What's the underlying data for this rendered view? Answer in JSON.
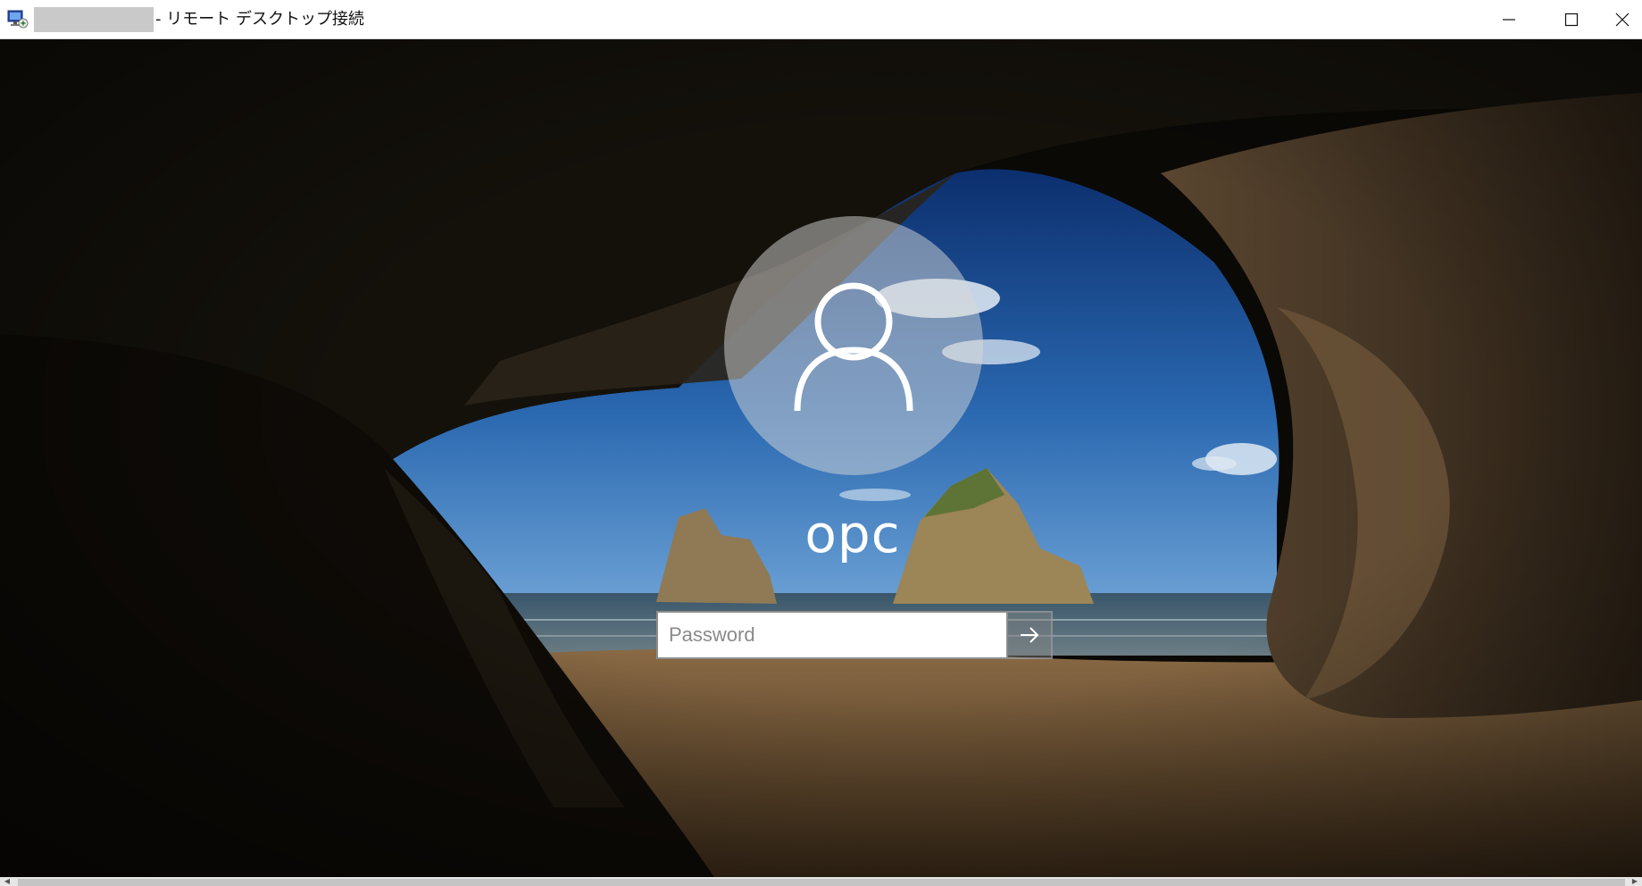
{
  "window": {
    "title": "- リモート デスクトップ接続",
    "app_icon": "remote-desktop-icon",
    "controls": {
      "minimize_icon": "minimize-icon",
      "maximize_icon": "maximize-icon",
      "close_icon": "close-icon"
    }
  },
  "login": {
    "username": "opc",
    "password_placeholder": "Password",
    "password_value": "",
    "avatar_icon": "user-icon",
    "submit_icon": "arrow-right-icon"
  },
  "colors": {
    "titlebar_bg": "#ffffff",
    "avatar_bg": "#d7d7d7",
    "text_on_lock": "#ffffff"
  }
}
